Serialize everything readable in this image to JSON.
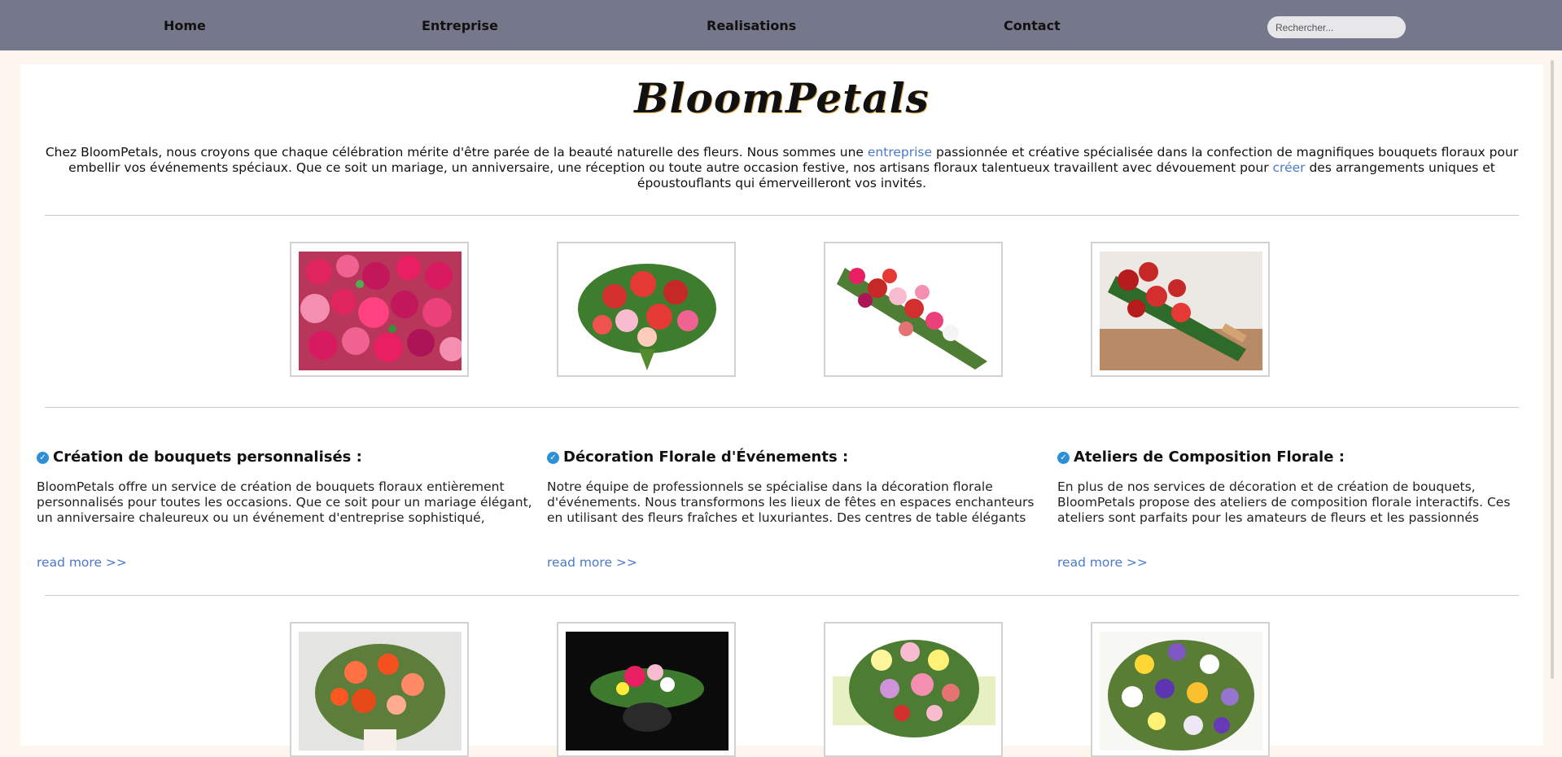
{
  "nav": {
    "items": [
      {
        "label": "Home"
      },
      {
        "label": "Entreprise"
      },
      {
        "label": "Realisations"
      },
      {
        "label": "Contact"
      }
    ],
    "search_placeholder": "Rechercher..."
  },
  "brand": {
    "title": "BloomPetals"
  },
  "intro": {
    "part1": "Chez BloomPetals, nous croyons que chaque célébration mérite d'être parée de la beauté naturelle des fleurs. Nous sommes une ",
    "link1": "entreprise",
    "part2": " passionnée et créative spécialisée dans la confection de magnifiques bouquets floraux pour embellir vos événements spéciaux. Que ce soit un mariage, un anniversaire, une réception ou toute autre occasion festive, nos artisans floraux talentueux travaillent avec dévouement pour ",
    "link2": "créer",
    "part3": " des arrangements uniques et époustouflants qui émerveilleront vos invités."
  },
  "features": [
    {
      "title": "Création de bouquets personnalisés :",
      "desc": "BloomPetals offre un service de création de bouquets floraux entièrement personnalisés pour toutes les occasions. Que ce soit pour un mariage élégant, un anniversaire chaleureux ou un événement d'entreprise sophistiqué,",
      "link": "read more >>"
    },
    {
      "title": "Décoration Florale d'Événements :",
      "desc": "Notre équipe de professionnels se spécialise dans la décoration florale d'événements. Nous transformons les lieux de fêtes en espaces enchanteurs en utilisant des fleurs fraîches et luxuriantes. Des centres de table élégants",
      "link": "read more >>"
    },
    {
      "title": "Ateliers de Composition Florale :",
      "desc": "En plus de nos services de décoration et de création de bouquets, BloomPetals propose des ateliers de composition florale interactifs. Ces ateliers sont parfaits pour les amateurs de fleurs et les passionnés",
      "link": "read more >>"
    }
  ],
  "colors": {
    "nav_bg": "#75788a",
    "page_bg": "#fdf6ee",
    "link": "#4b78c9",
    "check_icon": "#2d8fd6"
  }
}
